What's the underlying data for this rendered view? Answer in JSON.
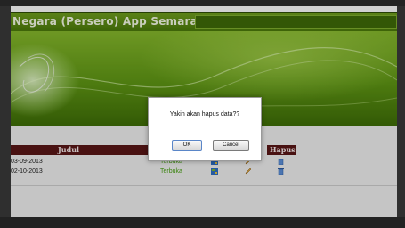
{
  "app": {
    "title": "Negara (Persero) App Semarang"
  },
  "table": {
    "headers": {
      "judul": "Judul",
      "hapus": "Hapus"
    },
    "rows": [
      {
        "date": "03-09-2013",
        "status": "Terbuka"
      },
      {
        "date": "02-10-2013",
        "status": "Terbuka"
      }
    ]
  },
  "dialog": {
    "message": "Yakin akan hapus data??",
    "ok_label": "OK",
    "cancel_label": "Cancel"
  },
  "colors": {
    "title_bar": "#5a8a12",
    "table_header": "#5a1717",
    "status_text": "#4aa216"
  },
  "icons": [
    "view-icon",
    "edit-icon",
    "delete-icon"
  ]
}
